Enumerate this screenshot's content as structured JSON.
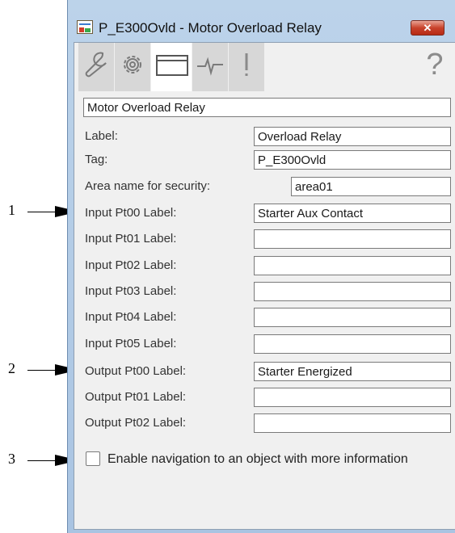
{
  "window": {
    "title": "P_E300Ovld - Motor Overload Relay",
    "close_glyph": "✕",
    "help_glyph": "?"
  },
  "tabs": [
    {
      "name": "wrench-icon",
      "active": false
    },
    {
      "name": "gear-icon",
      "active": false
    },
    {
      "name": "window-icon",
      "active": true
    },
    {
      "name": "trend-icon",
      "active": false
    },
    {
      "name": "exclamation-icon",
      "active": false
    }
  ],
  "description": "Motor Overload Relay",
  "rows": [
    {
      "label": "Label:",
      "value": "Overload Relay"
    },
    {
      "label": "Tag:",
      "value": "P_E300Ovld"
    },
    {
      "label": "Area name for security:",
      "value": "area01"
    },
    {
      "label": "Input Pt00 Label:",
      "value": "Starter Aux Contact"
    },
    {
      "label": "Input Pt01 Label:",
      "value": ""
    },
    {
      "label": "Input Pt02 Label:",
      "value": ""
    },
    {
      "label": "Input Pt03 Label:",
      "value": ""
    },
    {
      "label": "Input Pt04 Label:",
      "value": ""
    },
    {
      "label": "Input Pt05 Label:",
      "value": ""
    },
    {
      "label": "Output Pt00 Label:",
      "value": "Starter Energized"
    },
    {
      "label": "Output Pt01 Label:",
      "value": ""
    },
    {
      "label": "Output Pt02 Label:",
      "value": ""
    }
  ],
  "navigation_checkbox": {
    "label": "Enable navigation to an object with more information",
    "checked": false
  },
  "callouts": [
    "1",
    "2",
    "3"
  ],
  "colors": {
    "title_background": "#b6cde6",
    "close_button": "#c8432c",
    "panel_background": "#f0f0f0",
    "tab_inactive": "#d7d7d7",
    "tab_active": "#ffffff"
  }
}
